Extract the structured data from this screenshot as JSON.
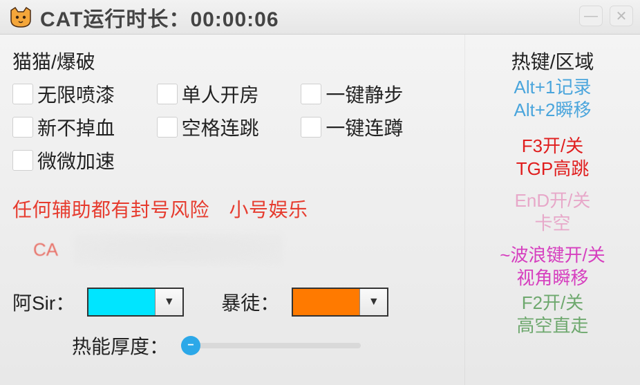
{
  "title": {
    "prefix": "CAT运行时长：",
    "time": "00:00:06"
  },
  "sections": {
    "left_title": "猫猫/爆破",
    "checkboxes": [
      "无限喷漆",
      "单人开房",
      "一键静步",
      "新不掉血",
      "空格连跳",
      "一键连蹲",
      "微微加速"
    ],
    "warning": "任何辅助都有封号风险　小号娱乐",
    "censored_prefix": "CA",
    "color_a_label": "阿Sir：",
    "color_b_label": "暴徒：",
    "colors": {
      "a": "#00e5ff",
      "b": "#ff7a00"
    },
    "slider_label": "热能厚度："
  },
  "right": {
    "title": "热键/区域",
    "hk1": "Alt+1记录\nAlt+2瞬移",
    "hk2": "F3开/关\nTGP高跳",
    "hk3": "EnD开/关\n卡空",
    "hk4": "~波浪键开/关\n视角瞬移",
    "hk5": "F2开/关\n高空直走"
  }
}
